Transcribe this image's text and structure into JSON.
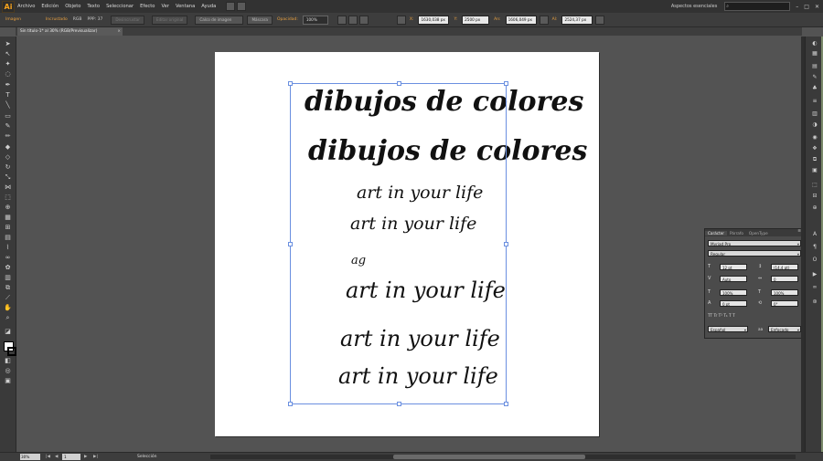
{
  "app": {
    "logo": "Ai",
    "accent": "#f7a31c"
  },
  "menu": [
    "Archivo",
    "Edición",
    "Objeto",
    "Texto",
    "Seleccionar",
    "Efecto",
    "Ver",
    "Ventana",
    "Ayuda"
  ],
  "workspace": {
    "label": "Aspectos esenciales",
    "search_placeholder": ""
  },
  "window_controls": {
    "minimize": "–",
    "maximize": "□",
    "close": "✕"
  },
  "control_bar": {
    "object_type": "Imagen",
    "link_status": "Incrustado",
    "color_mode": "RGB",
    "ppi": "PPP: 37",
    "buttons": [
      "Desincrustar",
      "Editar original",
      "Calco de imagen",
      "Máscara"
    ],
    "opacity_label": "Opacidad:",
    "opacity_value": "100%",
    "x_label": "X:",
    "x_value": "1630,038 px",
    "y_label": "Y:",
    "y_value": "2500 px",
    "w_label": "An:",
    "w_value": "1606,049 px",
    "h_label": "Al:",
    "h_value": "2524,37 px"
  },
  "document_tab": {
    "title": "Sin título-1* al 30% (RGB/Previsualizar)",
    "close": "×"
  },
  "artwork": {
    "lines": [
      "dibujos de colores",
      "dibujos de colores",
      "art in your life",
      "art in your life",
      "ag",
      "art in your life",
      "art in your life",
      "art in your life"
    ]
  },
  "character_panel": {
    "tabs": [
      "Carácter",
      "Párrafo",
      "OpenType"
    ],
    "font_family": "Myriad Pro",
    "font_style": "Regular",
    "font_size": "12 pt",
    "leading": "(14,4 pt)",
    "kerning": "Auto",
    "tracking": "0",
    "vscale": "100%",
    "hscale": "100%",
    "baseline": "0 pt",
    "rotation": "0°",
    "language": "Español",
    "antialias_label": "aa",
    "antialias": "Enfocado"
  },
  "status_bar": {
    "zoom": "30%",
    "page": "1",
    "tool": "Selección"
  }
}
